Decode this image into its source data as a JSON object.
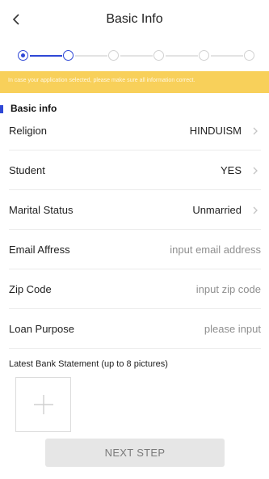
{
  "header": {
    "title": "Basic Info",
    "back_icon": "chevron-left-icon"
  },
  "stepper": {
    "total_steps": 6,
    "current_step": 2
  },
  "banner": {
    "text": "In case your application selected, please make sure all information correct."
  },
  "section": {
    "title": "Basic info"
  },
  "fields": [
    {
      "label": "Religion",
      "value": "HINDUISM"
    },
    {
      "label": "Student",
      "value": "YES"
    },
    {
      "label": "Marital Status",
      "value": "Unmarried"
    },
    {
      "label": "Email Affress",
      "placeholder": "input email address"
    },
    {
      "label": "Zip Code",
      "placeholder": "input zip code"
    },
    {
      "label": "Loan Purpose",
      "placeholder": "please input"
    }
  ],
  "upload": {
    "label": "Latest Bank Statement (up to 8 pictures)"
  },
  "next_button": {
    "label": "NEXT STEP"
  },
  "colors": {
    "accent": "#2f48d6",
    "banner": "#f8d05a",
    "button_disabled": "#e6e6e6"
  }
}
